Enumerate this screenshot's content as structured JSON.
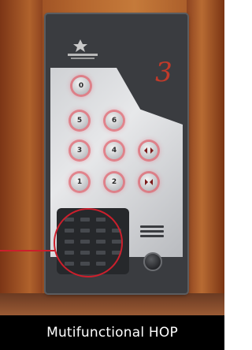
{
  "floor_display": "3",
  "caption": "Mutifunctional HOP",
  "keys": [
    "0",
    "5",
    "6",
    "3",
    "4",
    "1",
    "2"
  ],
  "colors": {
    "callout": "#cc1f2c",
    "key_glow": "#e86e82",
    "caption_bg": "#000000",
    "caption_text": "#ffffff"
  }
}
